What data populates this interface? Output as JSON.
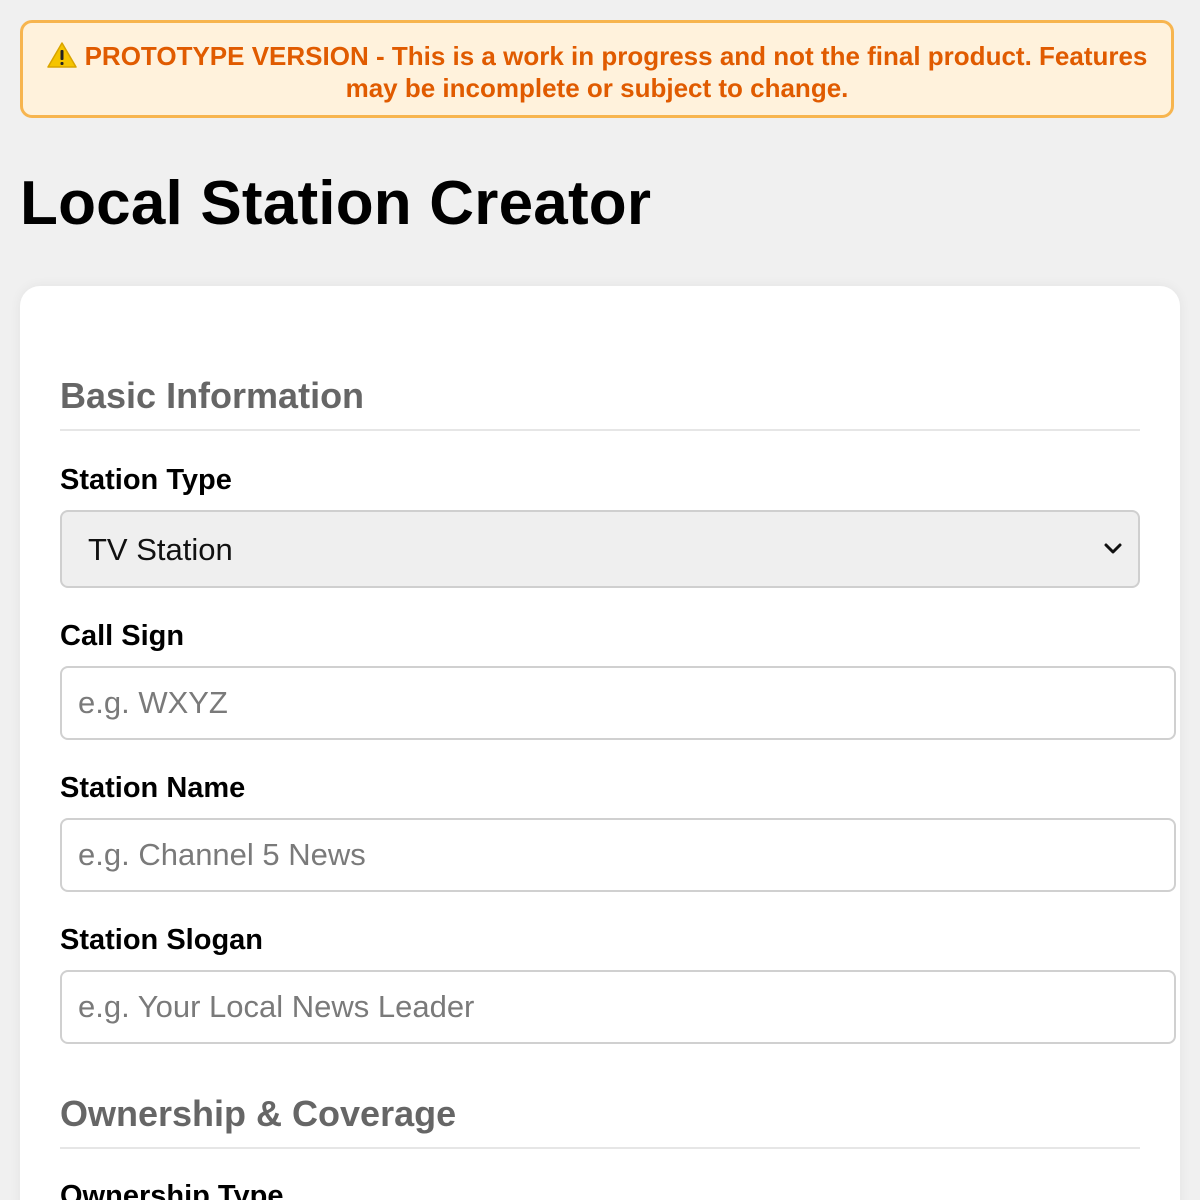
{
  "banner": {
    "icon": "warning-icon",
    "text": "PROTOTYPE VERSION - This is a work in progress and not the final product. Features may be incomplete or subject to change.",
    "color": "#e05b00",
    "background": "#fff2dc",
    "border_color": "#f7b54f"
  },
  "page": {
    "title": "Local Station Creator"
  },
  "form": {
    "basic_info": {
      "heading": "Basic Information",
      "station_type": {
        "label": "Station Type",
        "selected": "TV Station"
      },
      "call_sign": {
        "label": "Call Sign",
        "value": "",
        "placeholder": "e.g. WXYZ"
      },
      "station_name": {
        "label": "Station Name",
        "value": "",
        "placeholder": "e.g. Channel 5 News"
      },
      "station_slogan": {
        "label": "Station Slogan",
        "value": "",
        "placeholder": "e.g. Your Local News Leader"
      }
    },
    "ownership": {
      "heading": "Ownership & Coverage",
      "ownership_type": {
        "label": "Ownership Type"
      }
    }
  }
}
